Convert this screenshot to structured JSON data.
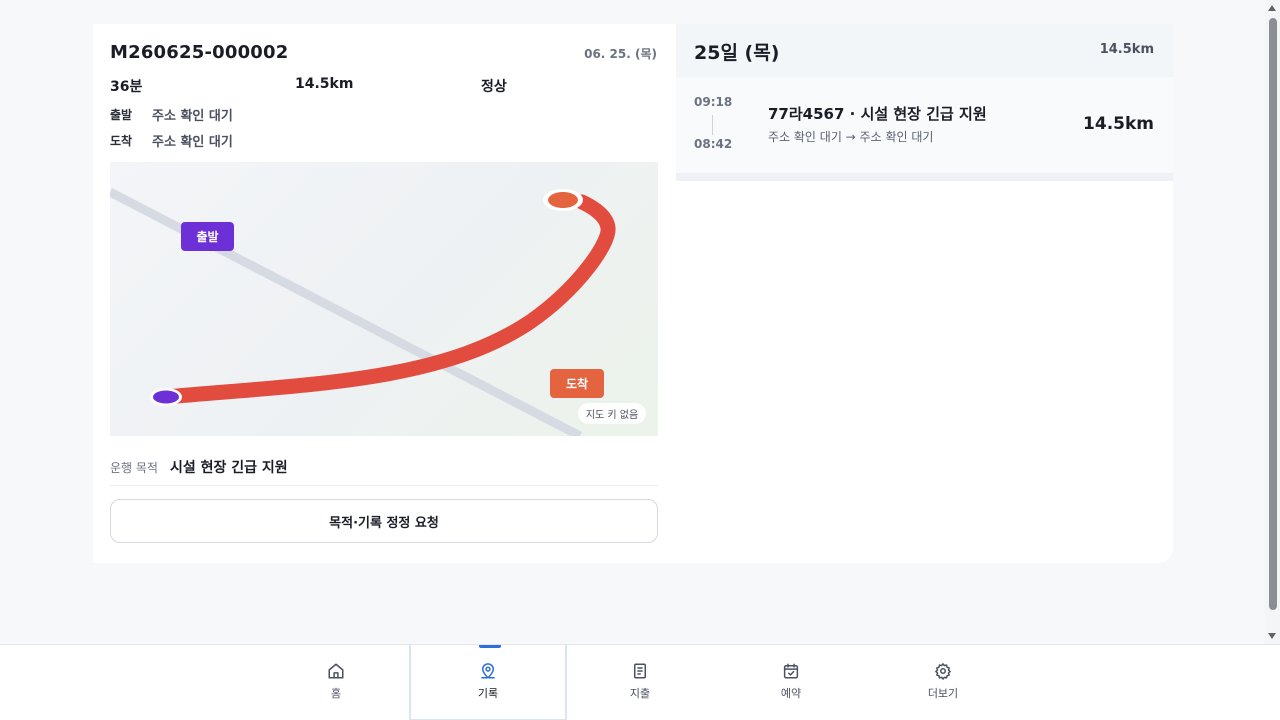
{
  "detail": {
    "trip_id": "M260625-000002",
    "date": "06. 25. (목)",
    "duration": "36분",
    "distance": "14.5km",
    "status": "정상",
    "start_label": "출발",
    "start_value": "주소 확인 대기",
    "end_label": "도착",
    "end_value": "주소 확인 대기",
    "map": {
      "start_tag": "출발",
      "end_tag": "도착",
      "no_key": "지도 키 없음",
      "start_color": "#6d2fd6",
      "end_color": "#e3643f",
      "route_color": "#e24c3f"
    },
    "purpose_label": "운행 목적",
    "purpose_value": "시설 현장 긴급 지원",
    "correction_button": "목적·기록 정정 요청"
  },
  "list": {
    "day_title": "25일 (목)",
    "day_total": "14.5km",
    "trips": [
      {
        "start_time": "09:18",
        "end_time": "08:42",
        "title": "77라4567 · 시설 현장 긴급 지원",
        "route": "주소 확인 대기 → 주소 확인 대기",
        "distance": "14.5km"
      }
    ]
  },
  "tabbar": {
    "active_color": "#2f6fd6",
    "tabs": [
      {
        "label": "홈",
        "icon": "home-icon"
      },
      {
        "label": "기록",
        "icon": "map-pin-icon",
        "active": true
      },
      {
        "label": "지출",
        "icon": "receipt-icon"
      },
      {
        "label": "예약",
        "icon": "calendar-check-icon"
      },
      {
        "label": "더보기",
        "icon": "gear-icon"
      }
    ]
  }
}
